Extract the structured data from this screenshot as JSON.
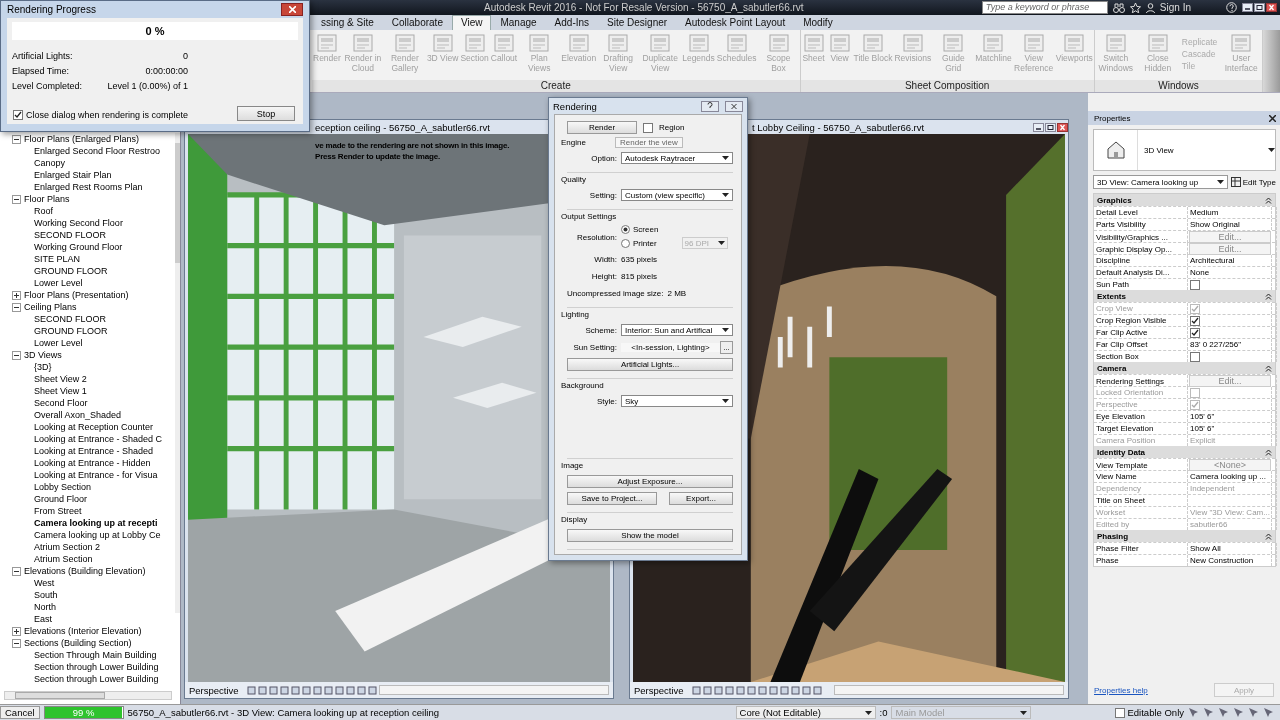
{
  "app_title": "Autodesk Revit 2016 - Not For Resale Version -    56750_A_sabutler66.rvt",
  "search": {
    "placeholder": "Type a keyword or phrase"
  },
  "sign_in": "Sign In",
  "ribbon_tabs": [
    {
      "label": "ssing & Site",
      "selected": false
    },
    {
      "label": "Collaborate",
      "selected": false
    },
    {
      "label": "View",
      "selected": true
    },
    {
      "label": "Manage",
      "selected": false
    },
    {
      "label": "Add-Ins",
      "selected": false
    },
    {
      "label": "Site Designer",
      "selected": false
    },
    {
      "label": "Autodesk Point Layout",
      "selected": false
    },
    {
      "label": "Modify",
      "selected": false
    }
  ],
  "ribbon_panels": [
    {
      "label": "Create",
      "tools": [
        {
          "kind": "large",
          "label": "Render"
        },
        {
          "kind": "large",
          "label": "Render in Cloud"
        },
        {
          "kind": "large",
          "label": "Render Gallery"
        },
        {
          "kind": "large",
          "label": "3D View"
        },
        {
          "kind": "large",
          "label": "Section"
        },
        {
          "kind": "large",
          "label": "Callout"
        },
        {
          "kind": "large",
          "label": "Plan Views"
        },
        {
          "kind": "large",
          "label": "Elevation"
        },
        {
          "kind": "large",
          "label": "Drafting View"
        },
        {
          "kind": "large",
          "label": "Duplicate View"
        },
        {
          "kind": "large",
          "label": "Legends"
        },
        {
          "kind": "large",
          "label": "Schedules"
        },
        {
          "kind": "large",
          "label": "Scope Box"
        }
      ]
    },
    {
      "label": "Sheet Composition",
      "tools": [
        {
          "kind": "large",
          "label": "Sheet"
        },
        {
          "kind": "large",
          "label": "View"
        },
        {
          "kind": "large",
          "label": "Title Block"
        },
        {
          "kind": "large",
          "label": "Revisions"
        },
        {
          "kind": "large",
          "label": "Guide Grid"
        },
        {
          "kind": "large",
          "label": "Matchline"
        },
        {
          "kind": "large",
          "label": "View Reference"
        },
        {
          "kind": "large",
          "label": "Viewports"
        }
      ]
    },
    {
      "label": "Windows",
      "tools": [
        {
          "kind": "large",
          "label": "Switch Windows"
        },
        {
          "kind": "large",
          "label": "Close Hidden"
        },
        {
          "kind": "stack",
          "items": [
            "Replicate",
            "Cascade",
            "Tile"
          ]
        },
        {
          "kind": "large",
          "label": "User Interface"
        }
      ]
    }
  ],
  "progress_dialog": {
    "title": "Rendering Progress",
    "percent": "0 %",
    "level": 0,
    "rows": [
      {
        "label": "Artificial Lights:",
        "value": "0"
      },
      {
        "label": "Elapsed Time:",
        "value": "0:00:00:00"
      },
      {
        "label": "Level Completed:",
        "value": "Level 1 (0.00%) of 1"
      }
    ],
    "close_when_complete": {
      "label": "Close dialog when rendering is complete",
      "checked": true
    },
    "stop": "Stop"
  },
  "browser": {
    "tree": [
      {
        "label": "Floor Plans (Enlarged Plans)",
        "expanded": true,
        "children": [
          {
            "label": "Enlarged Second Floor Restroo",
            "selected": false
          },
          {
            "label": "Canopy",
            "selected": false
          },
          {
            "label": "Enlarged Stair Plan",
            "selected": false
          },
          {
            "label": "Enlarged Rest Rooms Plan",
            "selected": false
          }
        ]
      },
      {
        "label": "Floor Plans",
        "expanded": true,
        "children": [
          {
            "label": "Roof",
            "selected": false
          },
          {
            "label": "Working Second Floor",
            "selected": false
          },
          {
            "label": "SECOND FLOOR",
            "selected": false
          },
          {
            "label": "Working Ground Floor",
            "selected": false
          },
          {
            "label": "SITE PLAN",
            "selected": false
          },
          {
            "label": "GROUND FLOOR",
            "selected": false
          },
          {
            "label": "Lower Level",
            "selected": false
          }
        ]
      },
      {
        "label": "Floor Plans (Presentation)",
        "expanded": false
      },
      {
        "label": "Ceiling Plans",
        "expanded": true,
        "children": [
          {
            "label": "SECOND FLOOR",
            "selected": false
          },
          {
            "label": "GROUND FLOOR",
            "selected": false
          },
          {
            "label": "Lower Level",
            "selected": false
          }
        ]
      },
      {
        "label": "3D Views",
        "expanded": true,
        "children": [
          {
            "label": "{3D}",
            "selected": false
          },
          {
            "label": "Sheet View 2",
            "selected": false
          },
          {
            "label": "Sheet View 1",
            "selected": false
          },
          {
            "label": "Second Floor",
            "selected": false
          },
          {
            "label": "Overall Axon_Shaded",
            "selected": false
          },
          {
            "label": "Looking at Reception Counter",
            "selected": false
          },
          {
            "label": "Looking at Entrance - Shaded C",
            "selected": false
          },
          {
            "label": "Looking at Entrance - Shaded",
            "selected": false
          },
          {
            "label": "Looking at Entrance - Hidden",
            "selected": false
          },
          {
            "label": "Looking at Entrance - for Visua",
            "selected": false
          },
          {
            "label": "Lobby Section",
            "selected": false
          },
          {
            "label": "Ground Floor",
            "selected": false
          },
          {
            "label": "From Street",
            "selected": false
          },
          {
            "label": "Camera looking up at recepti",
            "selected": true
          },
          {
            "label": "Camera looking up at Lobby Ce",
            "selected": false
          },
          {
            "label": "Atrium Section 2",
            "selected": false
          },
          {
            "label": "Atrium Section",
            "selected": false
          }
        ]
      },
      {
        "label": "Elevations (Building Elevation)",
        "expanded": true,
        "children": [
          {
            "label": "West",
            "selected": false
          },
          {
            "label": "South",
            "selected": false
          },
          {
            "label": "North",
            "selected": false
          },
          {
            "label": "East",
            "selected": false
          }
        ]
      },
      {
        "label": "Elevations (Interior Elevation)",
        "expanded": false
      },
      {
        "label": "Sections (Building Section)",
        "expanded": true,
        "children": [
          {
            "label": "Section Through Main Building",
            "selected": false
          },
          {
            "label": "Section through Lower Building",
            "selected": false
          },
          {
            "label": "Section through Lower Building",
            "selected": false
          }
        ]
      }
    ]
  },
  "views": [
    {
      "title": "eception ceiling - 56750_A_sabutler66.rvt",
      "warning": [
        "ve made to the rendering are not shown in this image.",
        "Press Render to update the image."
      ],
      "footer": "Perspective"
    },
    {
      "title": "t Lobby Ceiling - 56750_A_sabutler66.rvt",
      "footer": "Perspective"
    }
  ],
  "rendering_dialog": {
    "title": "Rendering",
    "render_button": "Render",
    "region": {
      "label": "Region",
      "checked": false
    },
    "tooltip": "Render the view",
    "sections": [
      {
        "heading": "Engine",
        "rows": [
          {
            "kind": "dropdown",
            "label": "Option:",
            "value": "Autodesk Raytracer"
          }
        ]
      },
      {
        "heading": "Quality",
        "rows": [
          {
            "kind": "dropdown",
            "label": "Setting:",
            "value": "Custom (view specific)"
          }
        ]
      },
      {
        "heading": "Output Settings",
        "rows": [
          {
            "kind": "radio",
            "label": "Resolution:",
            "options": [
              {
                "label": "Screen",
                "selected": true
              },
              {
                "label": "Printer",
                "selected": false
              }
            ],
            "dpi": "96 DPI"
          },
          {
            "kind": "info",
            "label": "Width:",
            "value": "635 pixels"
          },
          {
            "kind": "info",
            "label": "Height:",
            "value": "815 pixels"
          },
          {
            "kind": "info",
            "label": "Uncompressed image size:",
            "value": "2 MB"
          }
        ]
      },
      {
        "heading": "Lighting",
        "rows": [
          {
            "kind": "dropdown",
            "label": "Scheme:",
            "value": "Interior: Sun and Artifical"
          },
          {
            "kind": "browse",
            "label": "Sun Setting:",
            "value": "<In-session, Lighting>",
            "button": "..."
          },
          {
            "kind": "button",
            "value": "Artificial Lights..."
          }
        ]
      },
      {
        "heading": "Background",
        "rows": [
          {
            "kind": "dropdown",
            "label": "Style:",
            "value": "Sky"
          }
        ]
      }
    ],
    "footer_sections": [
      {
        "heading": "Image",
        "rows": [
          {
            "kind": "button",
            "value": "Adjust Exposure..."
          },
          {
            "kind": "pair",
            "values": [
              "Save to Project...",
              "Export..."
            ]
          }
        ]
      },
      {
        "heading": "Display",
        "rows": [
          {
            "kind": "button",
            "value": "Show the model"
          }
        ]
      }
    ]
  },
  "properties": {
    "title": "Properties",
    "type_name": "3D View",
    "instance": "3D View: Camera looking up",
    "edit_type": "Edit Type",
    "groups": [
      {
        "name": "Graphics",
        "rows": [
          {
            "label": "Detail Level",
            "kind": "text",
            "value": "Medium",
            "disabled": false
          },
          {
            "label": "Parts Visibility",
            "kind": "text",
            "value": "Show Original",
            "disabled": false
          },
          {
            "label": "Visibility/Graphics ...",
            "kind": "button",
            "value": "Edit...",
            "disabled": false
          },
          {
            "label": "Graphic Display Op...",
            "kind": "button",
            "value": "Edit...",
            "disabled": false
          },
          {
            "label": "Discipline",
            "kind": "text",
            "value": "Architectural",
            "disabled": false
          },
          {
            "label": "Default Analysis Di...",
            "kind": "text",
            "value": "None",
            "disabled": false
          },
          {
            "label": "Sun Path",
            "kind": "check",
            "checked": false,
            "disabled": false
          }
        ]
      },
      {
        "name": "Extents",
        "rows": [
          {
            "label": "Crop View",
            "kind": "check",
            "checked": true,
            "disabled": true
          },
          {
            "label": "Crop Region Visible",
            "kind": "check",
            "checked": true,
            "disabled": false
          },
          {
            "label": "Far Clip Active",
            "kind": "check",
            "checked": true,
            "disabled": false
          },
          {
            "label": "Far Clip Offset",
            "kind": "text",
            "value": "83'  0 227/256\"",
            "disabled": false
          },
          {
            "label": "Section Box",
            "kind": "check",
            "checked": false,
            "disabled": false
          }
        ]
      },
      {
        "name": "Camera",
        "rows": [
          {
            "label": "Rendering Settings",
            "kind": "button",
            "value": "Edit...",
            "disabled": false
          },
          {
            "label": "Locked Orientation",
            "kind": "check",
            "checked": false,
            "disabled": true
          },
          {
            "label": "Perspective",
            "kind": "check",
            "checked": true,
            "disabled": true
          },
          {
            "label": "Eye Elevation",
            "kind": "text",
            "value": "105'  6\"",
            "disabled": false
          },
          {
            "label": "Target Elevation",
            "kind": "text",
            "value": "105'  6\"",
            "disabled": false
          },
          {
            "label": "Camera Position",
            "kind": "text",
            "value": "Explicit",
            "disabled": true
          }
        ]
      },
      {
        "name": "Identity Data",
        "rows": [
          {
            "label": "View Template",
            "kind": "button",
            "value": "<None>",
            "disabled": false
          },
          {
            "label": "View Name",
            "kind": "text",
            "value": "Camera looking up ...",
            "disabled": false
          },
          {
            "label": "Dependency",
            "kind": "text",
            "value": "Independent",
            "disabled": true
          },
          {
            "label": "Title on Sheet",
            "kind": "text",
            "value": "",
            "disabled": false
          },
          {
            "label": "Workset",
            "kind": "text",
            "value": "View \"3D View: Cam...",
            "disabled": true
          },
          {
            "label": "Edited by",
            "kind": "text",
            "value": "sabutler66",
            "disabled": true
          }
        ]
      },
      {
        "name": "Phasing",
        "rows": [
          {
            "label": "Phase Filter",
            "kind": "text",
            "value": "Show All",
            "disabled": false
          },
          {
            "label": "Phase",
            "kind": "text",
            "value": "New Construction",
            "disabled": false
          }
        ]
      }
    ],
    "help_link": "Properties help",
    "apply": "Apply"
  },
  "status_bar": {
    "cancel": "Cancel",
    "progress": {
      "level": 0.99,
      "reading": "99 %"
    },
    "text": "56750_A_sabutler66.rvt - 3D View: Camera looking up at reception ceiling",
    "workset": "Core (Not Editable)",
    "count": ":0",
    "model": "Main Model",
    "editable_only": {
      "label": "Editable Only",
      "checked": false
    }
  }
}
